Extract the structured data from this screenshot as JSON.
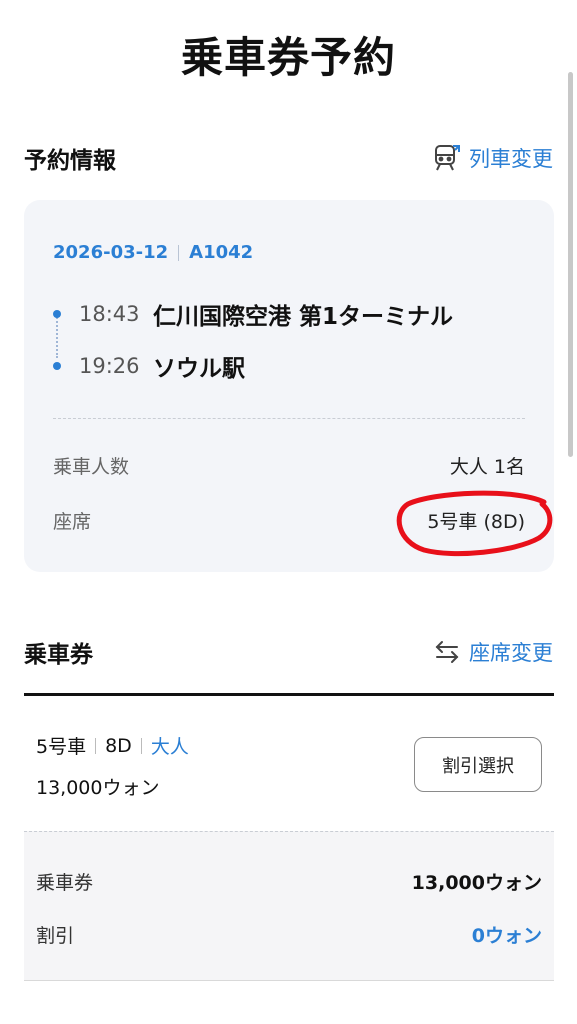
{
  "page": {
    "title": "乗車券予約"
  },
  "reservation": {
    "section_title": "予約情報",
    "change_train_label": "列車変更",
    "date": "2026-03-12",
    "train_no": "A1042",
    "departure": {
      "time": "18:43",
      "station": "仁川国際空港 第1ターミナル"
    },
    "arrival": {
      "time": "19:26",
      "station": "ソウル駅"
    },
    "passengers_label": "乗車人数",
    "passengers_value": "大人 1名",
    "seat_label": "座席",
    "seat_value": "5号車 (8D)"
  },
  "ticket": {
    "section_title": "乗車券",
    "change_seat_label": "座席変更",
    "car": "5号車",
    "seat": "8D",
    "passenger_type": "大人",
    "price": "13,000ウォン",
    "discount_button": "割引選択",
    "summary": {
      "fare_label": "乗車券",
      "fare_value": "13,000ウォン",
      "discount_label": "割引",
      "discount_value": "0ウォン"
    }
  },
  "colors": {
    "accent": "#2b7fd4",
    "annotation": "#e8101a",
    "card_bg": "#f3f5f9"
  }
}
